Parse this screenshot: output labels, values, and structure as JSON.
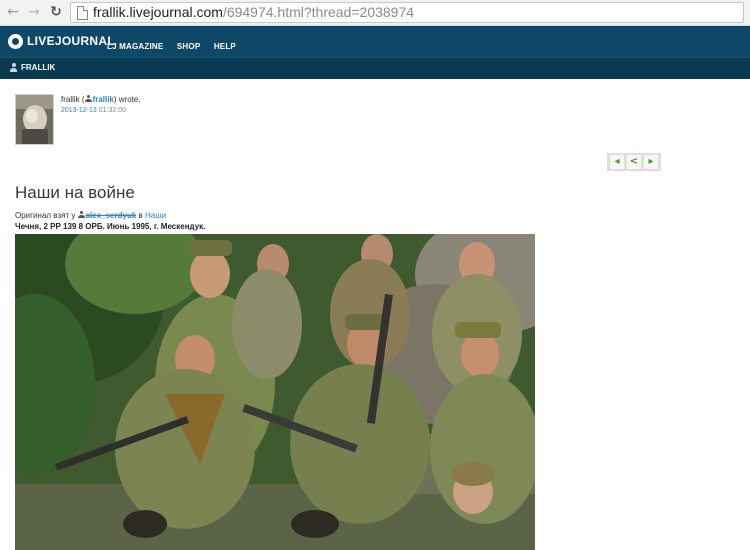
{
  "browser": {
    "url_host": "frallik.livejournal.com",
    "url_path": "/694974.html?thread=2038974"
  },
  "header": {
    "logo_text": "LIVEJOURNAL",
    "nav": [
      "LJ MAGAZINE",
      "SHOP",
      "HELP"
    ],
    "user": "FRALLIK"
  },
  "comment": {
    "author": "frallik",
    "open_paren": "(",
    "user_link": "frallik",
    "wrote": ") wrote,",
    "date": "2013-12-13",
    "time": "01:32:00"
  },
  "post": {
    "title": "Наши на войне",
    "original_prefix": "Оригинал взят у",
    "original_user": "alex_serdyuk",
    "in_word": "в",
    "original_post": "Наши",
    "caption": "Чечня, 2 РР 139 8 ОРБ. Июнь 1995, г. Мескендук."
  },
  "icons": {
    "back": "arrow-left-icon",
    "forward": "arrow-right-icon",
    "reload": "reload-icon",
    "page": "page-icon",
    "prev": "prev-arrow-icon",
    "share": "share-icon",
    "next": "next-arrow-icon"
  }
}
